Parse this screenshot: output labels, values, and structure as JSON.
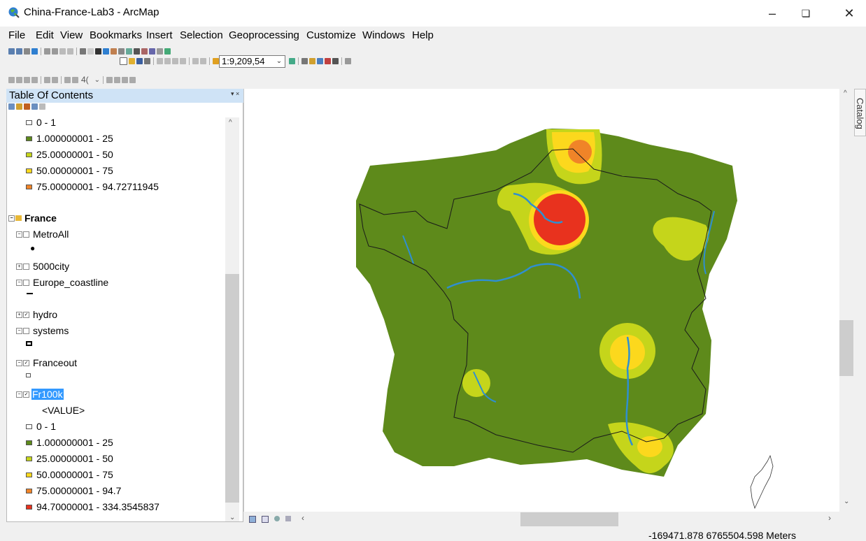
{
  "window": {
    "title": "China-France-Lab3 - ArcMap"
  },
  "menu": [
    "File",
    "Edit",
    "View",
    "Bookmarks",
    "Insert",
    "Selection",
    "Geoprocessing",
    "Customize",
    "Windows",
    "Help"
  ],
  "toolbar": {
    "scale_value": "1:9,209,54",
    "layer_value": "4("
  },
  "toc": {
    "title": "Table Of Contents",
    "top_classes": [
      {
        "label": "0 - 1",
        "color": "#ffffff"
      },
      {
        "label": "1.000000001 - 25",
        "color": "#5e8a1b"
      },
      {
        "label": "25.00000001 - 50",
        "color": "#c5d51b"
      },
      {
        "label": "50.00000001 - 75",
        "color": "#fcd81d"
      },
      {
        "label": "75.00000001 - 94.72711945",
        "color": "#f08428"
      }
    ],
    "group": "France",
    "layers": {
      "metroall": "MetroAll",
      "city5000": "5000city",
      "coastline": "Europe_coastline",
      "hydro": "hydro",
      "systems": "systems",
      "franceout": "Franceout",
      "fr100k": "Fr100k",
      "value": "<VALUE>"
    },
    "fr100k_classes": [
      {
        "label": "0 - 1",
        "color": "#ffffff"
      },
      {
        "label": "1.000000001 - 25",
        "color": "#5e8a1b"
      },
      {
        "label": "25.00000001 - 50",
        "color": "#c5d51b"
      },
      {
        "label": "50.00000001 - 75",
        "color": "#fcd81d"
      },
      {
        "label": "75.00000001 - 94.7",
        "color": "#f08428"
      },
      {
        "label": "94.70000001 - 334.3545837",
        "color": "#e8321e"
      }
    ]
  },
  "catalog_tab": "Catalog",
  "status": {
    "coordinates": "-169471.878  6765504.598 Meters"
  },
  "colors": {
    "green": "#5e8a1b",
    "lightgreen": "#c5d51b",
    "yellow": "#fcd81d",
    "orange": "#f08428",
    "red": "#e8321e",
    "river": "#2f8fd0"
  }
}
